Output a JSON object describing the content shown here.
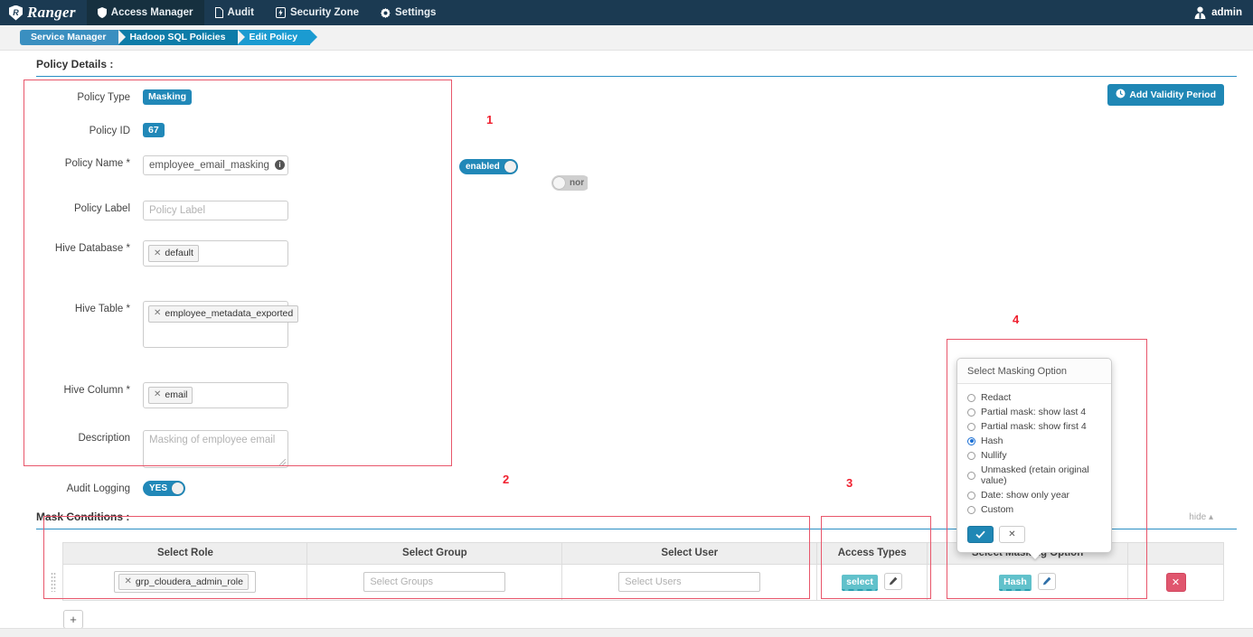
{
  "navbar": {
    "brand_mark": "R",
    "brand_name": "Ranger",
    "items": [
      {
        "label": "Access Manager",
        "icon": "shield-icon",
        "active": true
      },
      {
        "label": "Audit",
        "icon": "file-icon",
        "active": false
      },
      {
        "label": "Security Zone",
        "icon": "bolt-icon",
        "active": false
      },
      {
        "label": "Settings",
        "icon": "gear-icon",
        "active": false
      }
    ],
    "user": "admin",
    "user_icon": "user-avatar-icon"
  },
  "breadcrumb": [
    {
      "label": "Service Manager"
    },
    {
      "label": "Hadoop SQL Policies"
    },
    {
      "label": "Edit Policy"
    }
  ],
  "policy_details": {
    "section_title": "Policy Details :",
    "add_validity_label": "Add Validity Period",
    "add_validity_icon": "clock-icon",
    "fields": {
      "policy_type_label": "Policy Type",
      "policy_type_value": "Masking",
      "policy_id_label": "Policy ID",
      "policy_id_value": "67",
      "policy_name_label": "Policy Name *",
      "policy_name_value": "employee_email_masking",
      "policy_name_info_icon": "info-icon",
      "policy_label_label": "Policy Label",
      "policy_label_placeholder": "Policy Label",
      "hive_database_label": "Hive Database *",
      "hive_database_token": "default",
      "hive_table_label": "Hive Table *",
      "hive_table_token": "employee_metadata_exported",
      "hive_column_label": "Hive Column *",
      "hive_column_token": "email",
      "description_label": "Description",
      "description_value": "Masking of employee email",
      "audit_logging_label": "Audit Logging",
      "audit_logging_value": "YES"
    },
    "toggles": {
      "enabled_label": "enabled",
      "normal_label": "nor"
    }
  },
  "mask_conditions": {
    "section_title": "Mask Conditions :",
    "hide_label": "hide",
    "hide_icon": "caret-up-icon",
    "columns": [
      "Select Role",
      "Select Group",
      "Select User",
      "Access Types",
      "Select Masking Option",
      ""
    ],
    "rows": [
      {
        "role_token": "grp_cloudera_admin_role",
        "group_placeholder": "Select Groups",
        "user_placeholder": "Select Users",
        "access_type": "select",
        "access_edit_icon": "pencil-icon",
        "masking_option": "Hash",
        "masking_edit_icon": "pencil-icon",
        "delete_icon": "close-icon"
      }
    ],
    "add_row_label": "+"
  },
  "masking_popover": {
    "title": "Select Masking Option",
    "options": [
      {
        "label": "Redact",
        "selected": false
      },
      {
        "label": "Partial mask: show last 4",
        "selected": false
      },
      {
        "label": "Partial mask: show first 4",
        "selected": false
      },
      {
        "label": "Hash",
        "selected": true
      },
      {
        "label": "Nullify",
        "selected": false
      },
      {
        "label": "Unmasked (retain original value)",
        "selected": false
      },
      {
        "label": "Date: show only year",
        "selected": false
      },
      {
        "label": "Custom",
        "selected": false
      }
    ],
    "confirm_icon": "check-icon",
    "cancel_icon": "close-icon"
  },
  "annotations": [
    {
      "number": "1"
    },
    {
      "number": "2"
    },
    {
      "number": "3"
    },
    {
      "number": "4"
    }
  ],
  "colors": {
    "navbar": "#1b3a52",
    "accent": "#1f87b5",
    "badge_teal": "#2188b8",
    "access_badge": "#61c1cb",
    "delete": "#e0566e",
    "annotation": "#f01f2e"
  }
}
